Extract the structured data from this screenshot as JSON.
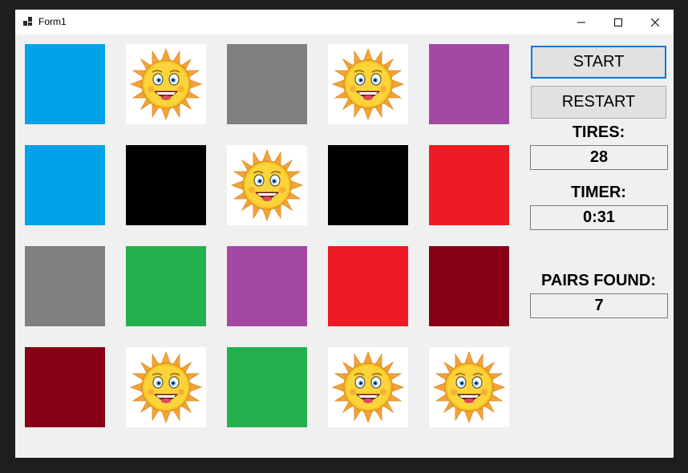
{
  "window": {
    "title": "Form1"
  },
  "controls": {
    "start_label": "START",
    "restart_label": "RESTART",
    "tries_label": "TIRES:",
    "tries_value": "28",
    "timer_label": "TIMER:",
    "timer_value": "0:31",
    "pairs_label": "PAIRS FOUND:",
    "pairs_value": "7"
  },
  "grid": {
    "rows": [
      [
        "light-blue",
        "sun",
        "gray",
        "sun",
        "purple"
      ],
      [
        "light-blue",
        "black",
        "sun",
        "black",
        "red"
      ],
      [
        "gray",
        "green",
        "purple",
        "red",
        "dark-red"
      ],
      [
        "dark-red",
        "sun",
        "green",
        "sun",
        "sun"
      ]
    ]
  },
  "colors": {
    "light-blue": "#00a2e8",
    "gray": "#7f7f7f",
    "purple": "#a349a4",
    "black": "#000000",
    "red": "#ed1c24",
    "green": "#22b14c",
    "dark-red": "#880015",
    "focus-border": "#0078d7"
  }
}
